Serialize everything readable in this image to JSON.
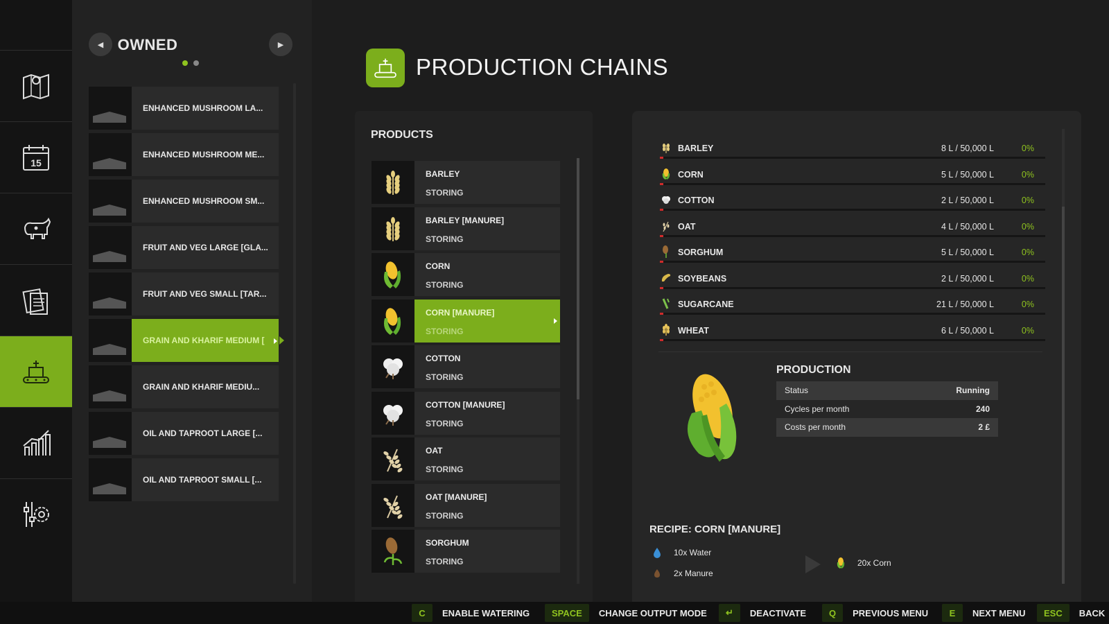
{
  "nav": {
    "items": [
      {
        "name": "map"
      },
      {
        "name": "calendar",
        "badge": "15"
      },
      {
        "name": "animals"
      },
      {
        "name": "contracts"
      },
      {
        "name": "production",
        "active": true
      },
      {
        "name": "statistics"
      },
      {
        "name": "settings"
      }
    ]
  },
  "owned": {
    "title": "OWNED",
    "pages": 2,
    "current_page": 1,
    "items": [
      {
        "label": "ENHANCED MUSHROOM LA..."
      },
      {
        "label": "ENHANCED MUSHROOM ME..."
      },
      {
        "label": "ENHANCED MUSHROOM SM..."
      },
      {
        "label": "FRUIT AND VEG LARGE [GLA..."
      },
      {
        "label": "FRUIT AND VEG SMALL [TAR..."
      },
      {
        "label": "GRAIN AND KHARIF MEDIUM [",
        "active": true
      },
      {
        "label": "GRAIN AND KHARIF MEDIU..."
      },
      {
        "label": "OIL AND TAPROOT LARGE [..."
      },
      {
        "label": "OIL AND TAPROOT SMALL [..."
      }
    ]
  },
  "header": {
    "title": "PRODUCTION CHAINS"
  },
  "products": {
    "title": "PRODUCTS",
    "items": [
      {
        "name": "BARLEY",
        "state": "STORING",
        "icon": "barley-icon"
      },
      {
        "name": "BARLEY [MANURE]",
        "state": "STORING",
        "icon": "barley-icon"
      },
      {
        "name": "CORN",
        "state": "STORING",
        "icon": "corn-icon"
      },
      {
        "name": "CORN [MANURE]",
        "state": "STORING",
        "icon": "corn-icon",
        "active": true
      },
      {
        "name": "COTTON",
        "state": "STORING",
        "icon": "cotton-icon"
      },
      {
        "name": "COTTON [MANURE]",
        "state": "STORING",
        "icon": "cotton-icon"
      },
      {
        "name": "OAT",
        "state": "STORING",
        "icon": "oat-icon"
      },
      {
        "name": "OAT [MANURE]",
        "state": "STORING",
        "icon": "oat-icon"
      },
      {
        "name": "SORGHUM",
        "state": "STORING",
        "icon": "sorghum-icon"
      }
    ]
  },
  "storage": {
    "rows": [
      {
        "name": "BARLEY",
        "amount": "8 L / 50,000 L",
        "pct": "0%",
        "fill": 0.0002,
        "icon": "barley-icon"
      },
      {
        "name": "CORN",
        "amount": "5 L / 50,000 L",
        "pct": "0%",
        "fill": 0.0001,
        "icon": "corn-icon"
      },
      {
        "name": "COTTON",
        "amount": "2 L / 50,000 L",
        "pct": "0%",
        "fill": 4e-05,
        "icon": "cotton-icon"
      },
      {
        "name": "OAT",
        "amount": "4 L / 50,000 L",
        "pct": "0%",
        "fill": 8e-05,
        "icon": "oat-icon"
      },
      {
        "name": "SORGHUM",
        "amount": "5 L / 50,000 L",
        "pct": "0%",
        "fill": 0.0001,
        "icon": "sorghum-icon"
      },
      {
        "name": "SOYBEANS",
        "amount": "2 L / 50,000 L",
        "pct": "0%",
        "fill": 4e-05,
        "icon": "soybean-icon"
      },
      {
        "name": "SUGARCANE",
        "amount": "21 L / 50,000 L",
        "pct": "0%",
        "fill": 0.0004,
        "icon": "sugarcane-icon"
      },
      {
        "name": "WHEAT",
        "amount": "6 L / 50,000 L",
        "pct": "0%",
        "fill": 0.0001,
        "icon": "wheat-icon"
      }
    ]
  },
  "production": {
    "title": "PRODUCTION",
    "rows": [
      {
        "label": "Status",
        "value": "Running"
      },
      {
        "label": "Cycles per month",
        "value": "240"
      },
      {
        "label": "Costs per month",
        "value": "2 £"
      }
    ]
  },
  "recipe": {
    "title": "RECIPE: CORN [MANURE]",
    "inputs": [
      {
        "label": "10x Water",
        "icon": "water-icon"
      },
      {
        "label": "2x Manure",
        "icon": "manure-icon"
      }
    ],
    "output": {
      "label": "20x Corn",
      "icon": "corn-icon"
    }
  },
  "hints": [
    {
      "key": "C",
      "label": "ENABLE WATERING"
    },
    {
      "key": "SPACE",
      "label": "CHANGE OUTPUT MODE"
    },
    {
      "key": "↵",
      "label": "DEACTIVATE"
    },
    {
      "key": "Q",
      "label": "PREVIOUS MENU"
    },
    {
      "key": "E",
      "label": "NEXT MENU"
    },
    {
      "key": "ESC",
      "label": "BACK"
    }
  ],
  "colors": {
    "accent": "#7cae1c",
    "accent_text": "#8fc31f",
    "bar_fill": "#d02b2b",
    "panel": "#222222"
  }
}
